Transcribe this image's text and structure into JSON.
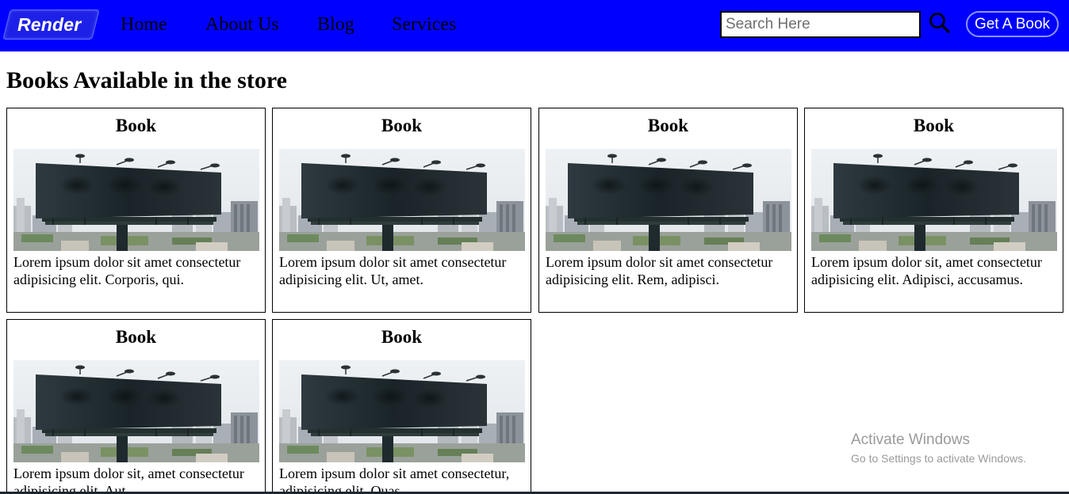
{
  "navbar": {
    "logo": "Render",
    "links": [
      "Home",
      "About Us",
      "Blog",
      "Services"
    ],
    "search_placeholder": "Search Here",
    "search_icon": "search-icon",
    "cta": "Get A Book",
    "colors": {
      "background": "#0000ff",
      "cta_border": "#8f95ff"
    }
  },
  "main": {
    "title": "Books Available in the store",
    "cards": [
      {
        "title": "Book",
        "image": "billboard-photo",
        "desc": "Lorem ipsum dolor sit amet consectetur adipisicing elit. Corporis, qui."
      },
      {
        "title": "Book",
        "image": "billboard-photo",
        "desc": "Lorem ipsum dolor sit amet consectetur adipisicing elit. Ut, amet."
      },
      {
        "title": "Book",
        "image": "billboard-photo",
        "desc": "Lorem ipsum dolor sit amet consectetur adipisicing elit. Rem, adipisci."
      },
      {
        "title": "Book",
        "image": "billboard-photo",
        "desc": "Lorem ipsum dolor sit, amet consectetur adipisicing elit. Adipisci, accusamus."
      },
      {
        "title": "Book",
        "image": "billboard-photo",
        "desc": "Lorem ipsum dolor sit, amet consectetur adipisicing elit. Aut"
      },
      {
        "title": "Book",
        "image": "billboard-photo",
        "desc": "Lorem ipsum dolor sit amet consectetur, adipisicing elit. Quas"
      }
    ]
  },
  "watermark": {
    "title": "Activate Windows",
    "subtitle": "Go to Settings to activate Windows."
  }
}
